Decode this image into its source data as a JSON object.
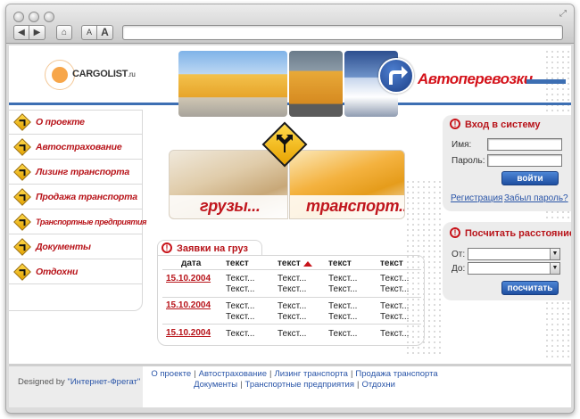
{
  "browser": {
    "back_glyph": "◀",
    "forward_glyph": "▶",
    "home_glyph": "⌂",
    "text_smaller": "A",
    "text_larger": "A",
    "address": ""
  },
  "header": {
    "logo_text": "CARGOLIST",
    "logo_tld": ".ru",
    "brand_title": "Автоперевозки",
    "accent_color": "#d4121a",
    "blue_color": "#3d6fb3"
  },
  "nav": {
    "items": [
      {
        "label": "О проекте"
      },
      {
        "label": "Автострахование"
      },
      {
        "label": "Лизинг транспорта"
      },
      {
        "label": "Продажа транспорта"
      },
      {
        "label": "Транспортные предприятия"
      },
      {
        "label": "Документы"
      },
      {
        "label": "Отдохни"
      }
    ]
  },
  "banner": {
    "left_word": "грузы...",
    "right_word": "транспорт..."
  },
  "orders": {
    "title": "Заявки на груз",
    "columns": [
      "дата",
      "текст",
      "текст",
      "текст",
      "текст"
    ],
    "rows": [
      {
        "date": "15.10.2004",
        "cells": [
          "Текст...\nТекст...",
          "Текст...\nТекст...",
          "Текст...\nТекст...",
          "Текст...\nТекст..."
        ]
      },
      {
        "date": "15.10.2004",
        "cells": [
          "Текст...\nТекст...",
          "Текст...\nТекст...",
          "Текст...\nТекст...",
          "Текст...\nТекст..."
        ]
      },
      {
        "date": "15.10.2004",
        "cells": [
          "Текст...",
          "Текст...",
          "Текст...",
          "Текст..."
        ]
      }
    ]
  },
  "login": {
    "title": "Вход в систему",
    "name_label": "Имя:",
    "password_label": "Пароль:",
    "submit": "войти",
    "register": "Регистрация",
    "forgot": "Забыл пароль?"
  },
  "distance": {
    "title": "Посчитать расстояние",
    "from_label": "От:",
    "to_label": "До:",
    "submit": "посчитать"
  },
  "footer": {
    "designed_prefix": "Designed by ",
    "designed_by": "\"Интернет-Фрегат\"",
    "links_row1": [
      "О проекте",
      "Автострахование",
      "Лизинг транспорта",
      "Продажа транспорта"
    ],
    "links_row2": [
      "Документы",
      "Транспортные предприятия",
      "Отдохни"
    ]
  }
}
